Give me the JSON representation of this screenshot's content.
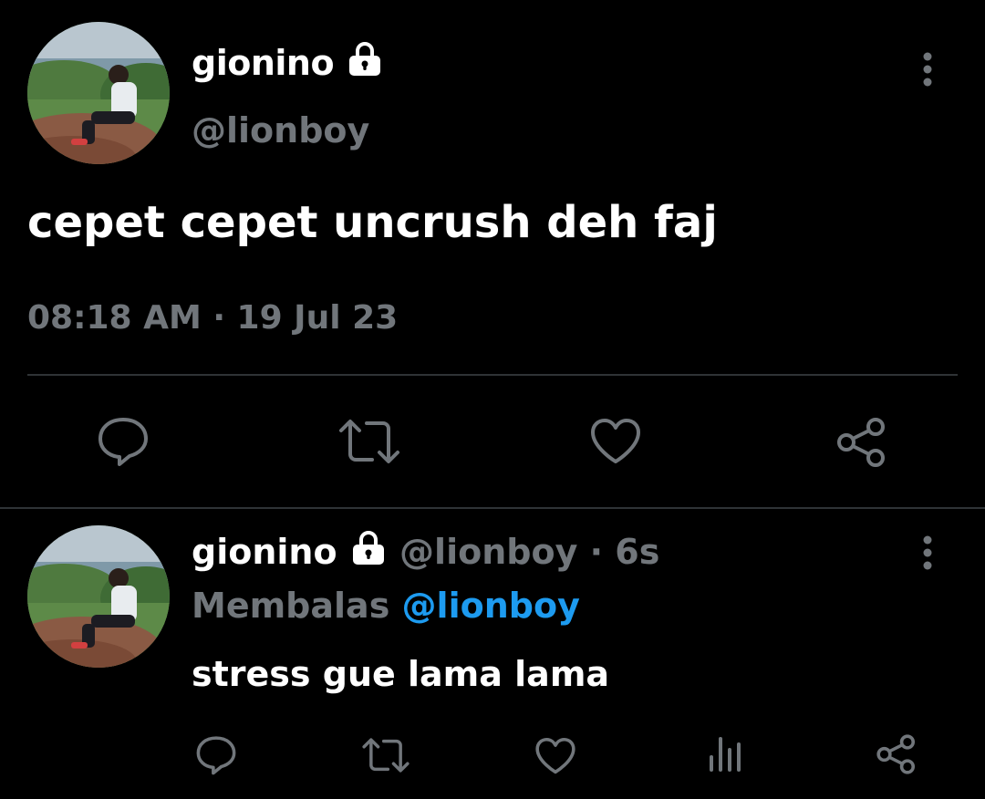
{
  "main_tweet": {
    "display_name": "gionino",
    "handle": "@lionboy",
    "text": "cepet cepet uncrush deh faj",
    "timestamp": "08:18 AM · 19 Jul 23",
    "actions": [
      "reply-icon",
      "retweet-icon",
      "like-icon",
      "share-icon"
    ]
  },
  "reply_tweet": {
    "display_name": "gionino",
    "handle": "@lionboy",
    "separator": "·",
    "age": "6s",
    "replying_label": "Membalas",
    "replying_to": "@lionboy",
    "text": "stress gue lama lama",
    "actions": [
      "reply-icon",
      "retweet-icon",
      "like-icon",
      "views-icon",
      "share-icon"
    ]
  },
  "colors": {
    "background": "#000000",
    "text": "#ffffff",
    "muted": "#71767b",
    "link": "#1d9bf0",
    "divider": "#2f3336"
  }
}
